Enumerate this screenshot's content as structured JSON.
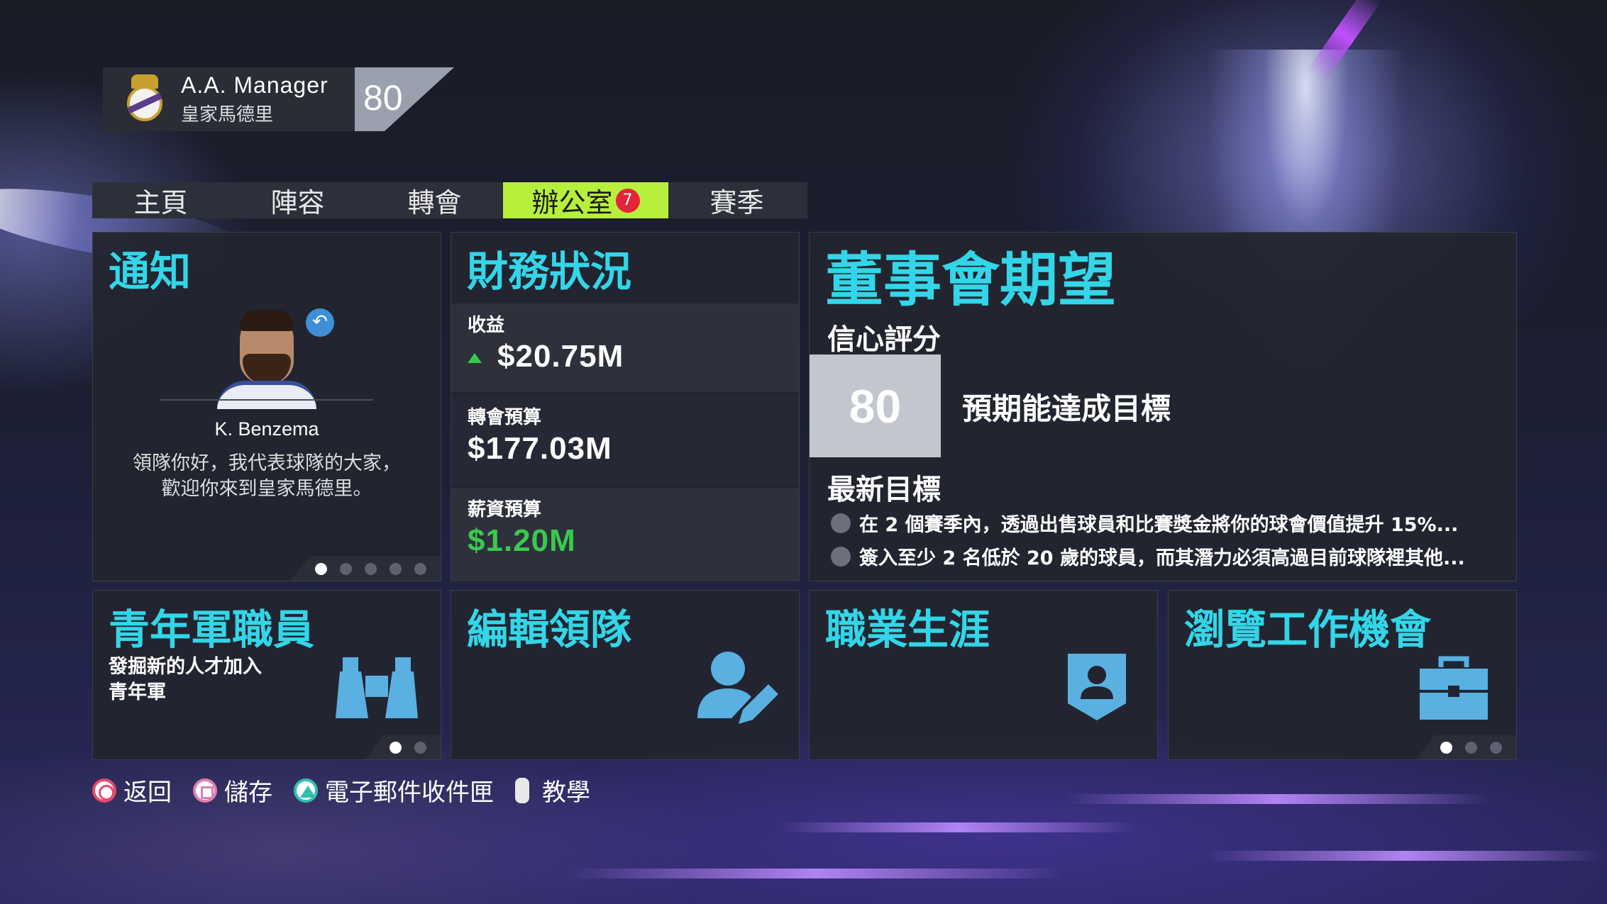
{
  "profile": {
    "name": "A.A. Manager",
    "club": "皇家馬德里",
    "rating": "80"
  },
  "tabs": [
    {
      "label": "主頁"
    },
    {
      "label": "陣容"
    },
    {
      "label": "轉會"
    },
    {
      "label": "辦公室",
      "badge": "7",
      "active": true
    },
    {
      "label": "賽季"
    }
  ],
  "notifications": {
    "title": "通知",
    "player_name": "K. Benzema",
    "message_line1": "領隊你好，我代表球隊的大家，",
    "message_line2": "歡迎你來到皇家馬德里。",
    "page_count": 5,
    "current_page": 1
  },
  "finance": {
    "title": "財務狀況",
    "revenue_label": "收益",
    "revenue_value": "$20.75M",
    "transfer_label": "轉會預算",
    "transfer_value": "$177.03M",
    "wage_label": "薪資預算",
    "wage_value": "$1.20M"
  },
  "board": {
    "title": "董事會期望",
    "confidence_label": "信心評分",
    "confidence_value": "80",
    "confidence_text": "預期能達成目標",
    "objectives_label": "最新目標",
    "objectives": [
      "在 2 個賽季內，透過出售球員和比賽獎金將你的球會價值提升 15%...",
      "簽入至少 2 名低於 20 歲的球員，而其潛力必須高過目前球隊裡其他..."
    ]
  },
  "tiles": {
    "youth": {
      "title": "青年軍職員",
      "subtitle_line1": "發掘新的人才加入",
      "subtitle_line2": "青年軍",
      "icon": "binoculars-icon"
    },
    "edit": {
      "title": "編輯領隊",
      "icon": "edit-user-icon"
    },
    "career": {
      "title": "職業生涯",
      "icon": "profile-badge-icon"
    },
    "jobs": {
      "title": "瀏覽工作機會",
      "icon": "briefcase-icon"
    }
  },
  "footer": {
    "back": "返回",
    "save": "儲存",
    "inbox": "電子郵件收件匣",
    "tutorial": "教學"
  },
  "colors": {
    "accent": "#33d6e8",
    "tab_active": "#b8ef3c",
    "positive": "#39c94f",
    "badge": "#e5243b"
  }
}
